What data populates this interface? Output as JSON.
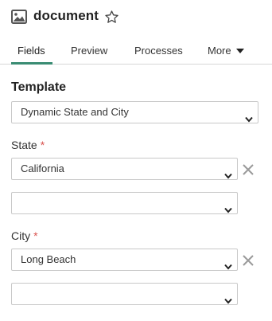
{
  "header": {
    "title": "document",
    "icon": "image-icon",
    "favorite_icon": "star-outline-icon"
  },
  "tabs": [
    {
      "label": "Fields",
      "active": true
    },
    {
      "label": "Preview",
      "active": false
    },
    {
      "label": "Processes",
      "active": false
    },
    {
      "label": "More",
      "active": false
    }
  ],
  "form": {
    "template": {
      "label": "Template",
      "value": "Dynamic State and City"
    },
    "state": {
      "label": "State",
      "required_marker": "*",
      "value": "California",
      "secondary_value": ""
    },
    "city": {
      "label": "City",
      "required_marker": "*",
      "value": "Long Beach",
      "secondary_value": ""
    }
  },
  "colors": {
    "accent": "#3a8c73",
    "required": "#d9534f",
    "border": "#c8c8c8"
  }
}
